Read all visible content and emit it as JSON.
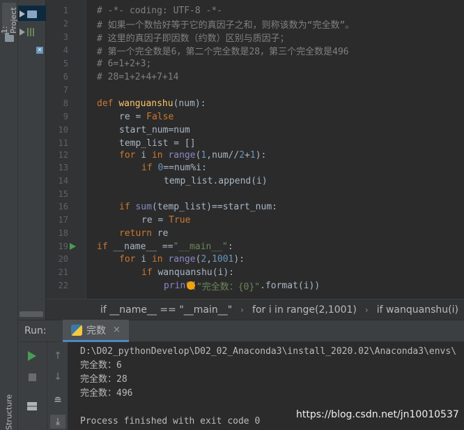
{
  "sidebar": {
    "project_tab": "1: Project",
    "structure_tab": "Structure"
  },
  "editor": {
    "line_numbers": [
      "1",
      "2",
      "3",
      "4",
      "5",
      "6",
      "7",
      "8",
      "9",
      "10",
      "11",
      "12",
      "13",
      "14",
      "15",
      "16",
      "17",
      "18",
      "19",
      "20",
      "21",
      "22"
    ],
    "line1": "# -*- coding: UTF-8 -*-",
    "line2": "# 如果一个数恰好等于它的真因子之和，则称该数为“完全数”。",
    "line3": "# 这里的真因子即因数（约数）区别与质因子；",
    "line4": "# 第一个完全数是6，第二个完全数是28，第三个完全数是496",
    "line5": "# 6=1+2+3;",
    "line6": "# 28=1+2+4+7+14",
    "kw_def": "def",
    "fn_name": "wanguanshu",
    "fn_params": "(num):",
    "l9_a": "re = ",
    "kw_false": "False",
    "l10": "start_num=num",
    "l11": "temp_list = []",
    "kw_for": "for",
    "l12_i": " i ",
    "kw_in": "in",
    "bi_range": "range",
    "l12_p1": "(",
    "num_1": "1",
    "l12_p2": ",num//",
    "num_2": "2",
    "l12_p3": "+",
    "num_1b": "1",
    "l12_p4": "):",
    "kw_if": "if",
    "num_0": "0",
    "l13_rest": "==num%i:",
    "l14": "temp_list.append(i)",
    "bi_sum": "sum",
    "l16_rest": "(temp_list)==start_num:",
    "l17_a": "re = ",
    "kw_true": "True",
    "kw_return": "return",
    "l18_rest": " re",
    "l19_name": " __name__ ==",
    "str_main": "\"__main__\"",
    "l19_colon": ":",
    "num_2b": "2",
    "l20_comma": ",",
    "num_1001": "1001",
    "l20_end": "):",
    "l21_rest": " wanquanshu(i):",
    "bi_print": "print",
    "l22_paren": "(",
    "str_fmt": "\"完全数：{0}\"",
    "l22_rest": ".format(i))"
  },
  "breadcrumbs": {
    "items": [
      "if __name__ == \"__main__\"",
      "for i in range(2,1001)",
      "if wanquanshu(i)"
    ]
  },
  "run_panel": {
    "label": "Run:",
    "tab_name": "完数",
    "tab_close": "×",
    "console_lines": [
      "D:\\D02_pythonDevelop\\D02_02_Anaconda3\\install_2020.02\\Anaconda3\\envs\\",
      "完全数：6",
      "完全数：28",
      "完全数：496",
      "",
      "Process finished with exit code 0"
    ]
  },
  "watermark": "https://blog.csdn.net/jn10010537",
  "colors": {
    "keyword": "#cc7832",
    "function": "#ffc66d",
    "string": "#6a8759",
    "number": "#6897bb",
    "comment": "#808080",
    "builtin": "#8888c6",
    "background": "#2b2b2b"
  }
}
